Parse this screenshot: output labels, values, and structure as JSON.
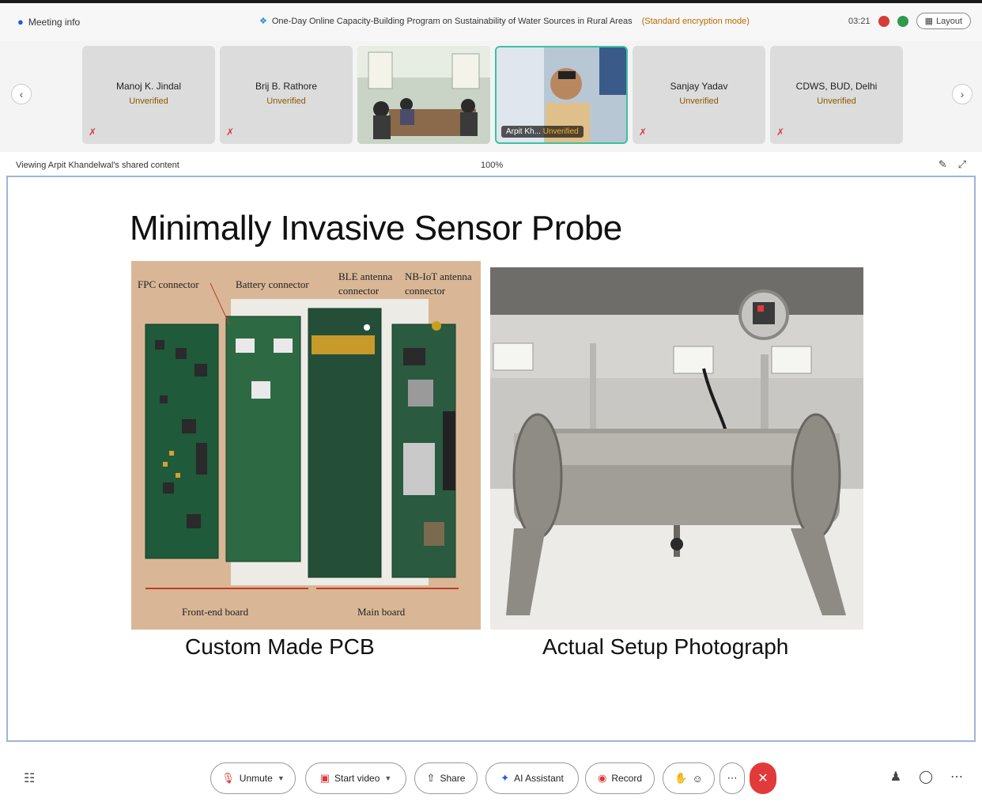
{
  "topbar": {
    "meeting_info": "Meeting info",
    "meeting_title": "One-Day Online Capacity-Building Program on Sustainability of Water Sources in Rural Areas",
    "encryption": "(Standard encryption mode)",
    "time": "03:21",
    "layout_label": "Layout"
  },
  "participants": [
    {
      "name": "Manoj K. Jindal",
      "status": "Unverified"
    },
    {
      "name": "Brij B. Rathore",
      "status": "Unverified"
    },
    {
      "name": "",
      "status": ""
    },
    {
      "name": "Arpit Kh...",
      "status": "Unverified",
      "video_label": "Arpit Kh..."
    },
    {
      "name": "Sanjay Yadav",
      "status": "Unverified"
    },
    {
      "name": "CDWS, BUD, Delhi",
      "status": "Unverified"
    }
  ],
  "viewing": {
    "text": "Viewing Arpit Khandelwal's shared content",
    "zoom": "100%"
  },
  "slide": {
    "title": "Minimally Invasive Sensor Probe",
    "caption_left": "Custom Made PCB",
    "caption_right": "Actual Setup Photograph",
    "pcb_labels": {
      "fpc": "FPC connector",
      "battery": "Battery connector",
      "ble": "BLE antenna",
      "ble2": "connector",
      "nbiot": "NB-IoT antenna",
      "nbiot2": "connector",
      "front": "Front-end board",
      "main": "Main board"
    }
  },
  "toolbar": {
    "unmute": "Unmute",
    "start_video": "Start video",
    "share": "Share",
    "ai_assistant": "AI Assistant",
    "record": "Record"
  },
  "colors": {
    "accent_red": "#e23a3a",
    "active_border": "#3ec0a0",
    "share_border": "#9fb4d8"
  }
}
